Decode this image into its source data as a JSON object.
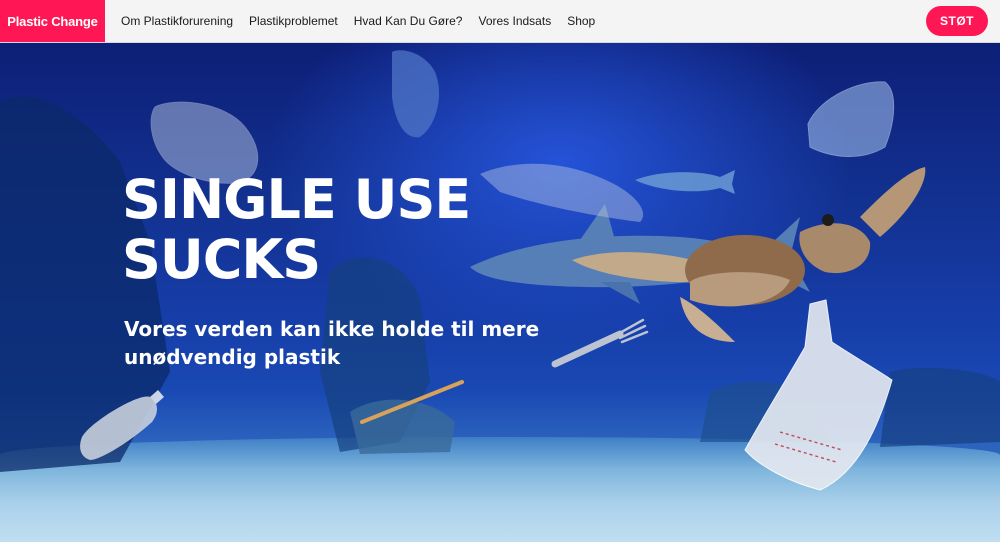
{
  "brand": {
    "logo_text": "Plastic Change",
    "accent_color": "#ff1755"
  },
  "nav": {
    "items": [
      {
        "label": "Om Plastikforurening"
      },
      {
        "label": "Plastikproblemet"
      },
      {
        "label": "Hvad Kan Du Gøre?"
      },
      {
        "label": "Vores Indsats"
      },
      {
        "label": "Shop"
      }
    ],
    "cta_label": "STØT"
  },
  "hero": {
    "headline": "SINGLE USE SUCKS",
    "subheadline": "Vores verden kan ikke holde til mere unødvendig plastik",
    "background_icon": "underwater-scene"
  }
}
